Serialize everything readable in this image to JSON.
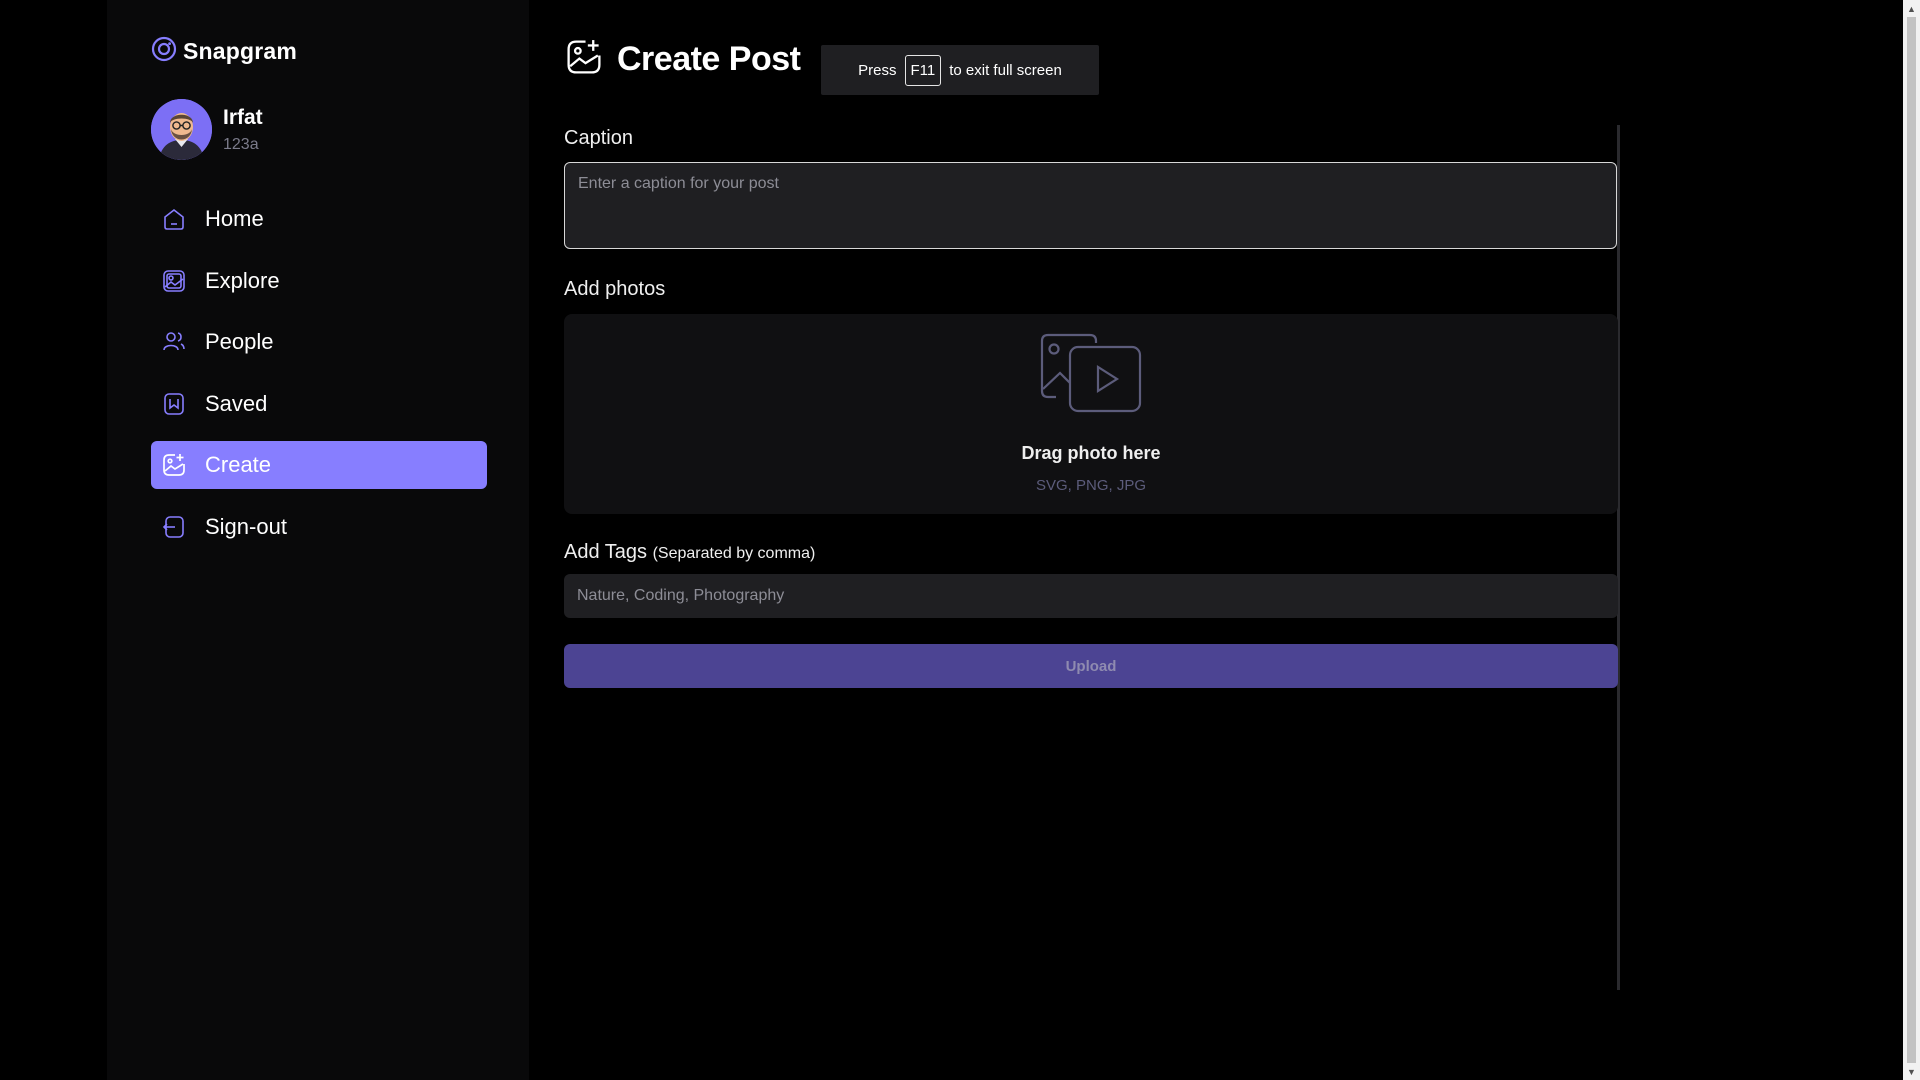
{
  "app": {
    "name": "Snapgram",
    "logo_icon": "camera-ring-icon"
  },
  "user": {
    "name": "Irfat",
    "handle": "123a"
  },
  "nav": [
    {
      "label": "Home",
      "icon": "home-icon",
      "active": false
    },
    {
      "label": "Explore",
      "icon": "gallery-icon",
      "active": false
    },
    {
      "label": "People",
      "icon": "people-icon",
      "active": false
    },
    {
      "label": "Saved",
      "icon": "bookmark-icon",
      "active": false
    },
    {
      "label": "Create",
      "icon": "gallery-add-icon",
      "active": true
    },
    {
      "label": "Sign-out",
      "icon": "logout-icon",
      "active": false
    }
  ],
  "page": {
    "title": "Create Post",
    "icon": "gallery-add-icon"
  },
  "fullscreen_toast": {
    "before": "Press",
    "key": "F11",
    "after": "to exit full screen"
  },
  "form": {
    "caption_label": "Caption",
    "caption_placeholder": "Enter a caption for your post",
    "photos_label": "Add photos",
    "dropzone_title": "Drag photo here",
    "dropzone_formats": "SVG, PNG, JPG",
    "tags_label": "Add Tags",
    "tags_hint": "(Separated by comma)",
    "tags_placeholder": "Nature, Coding, Photography",
    "upload_label": "Upload"
  },
  "colors": {
    "accent": "#877eff",
    "upload_disabled": "#4c4493",
    "sidebar_bg": "#09090a",
    "input_bg": "#1f1f22"
  }
}
